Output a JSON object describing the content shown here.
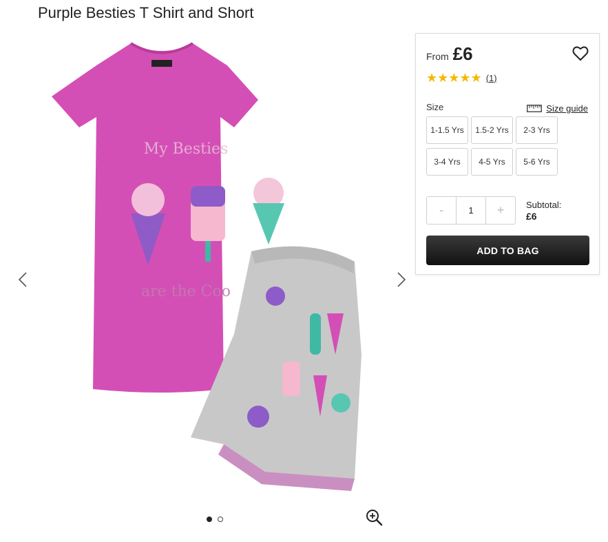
{
  "product": {
    "title": "Purple Besties T Shirt and Short"
  },
  "purchase_panel": {
    "price_prefix": "From",
    "price": "£6",
    "rating_stars": 5,
    "stars_text": "★★★★★",
    "review_count": "(1)",
    "size_label": "Size",
    "size_guide_label": "Size guide",
    "sizes": [
      "1-1.5 Yrs",
      "1.5-2 Yrs",
      "2-3 Yrs",
      "3-4 Yrs",
      "4-5 Yrs",
      "5-6 Yrs"
    ],
    "quantity": {
      "minus": "-",
      "value": "1",
      "plus": "+"
    },
    "subtotal_label": "Subtotal:",
    "subtotal_value": "£6",
    "add_to_bag_label": "ADD TO BAG"
  },
  "gallery": {
    "active_slide": 1,
    "slide_count": 2
  },
  "colors": {
    "shirt": "#d44fb5",
    "shorts": "#c4c4c4",
    "star": "#f5b800",
    "button": "#1a1a1a"
  },
  "icons": [
    "heart-icon",
    "ruler-icon",
    "chevron-left-icon",
    "chevron-right-icon",
    "zoom-in-icon"
  ]
}
